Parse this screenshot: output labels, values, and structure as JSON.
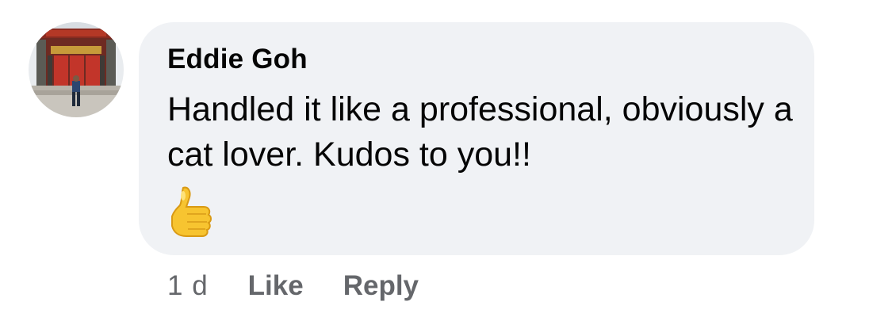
{
  "comment": {
    "author": "Eddie Goh",
    "text": "Handled it like a professional, obviously a cat lover. Kudos to you!!",
    "emoji_icon": "thumbs-up-emoji-icon",
    "timestamp": "1 d",
    "like_label": "Like",
    "reply_label": "Reply"
  },
  "colors": {
    "bubble_background": "#f0f2f5",
    "text_primary": "#050505",
    "text_secondary": "#65676b"
  }
}
